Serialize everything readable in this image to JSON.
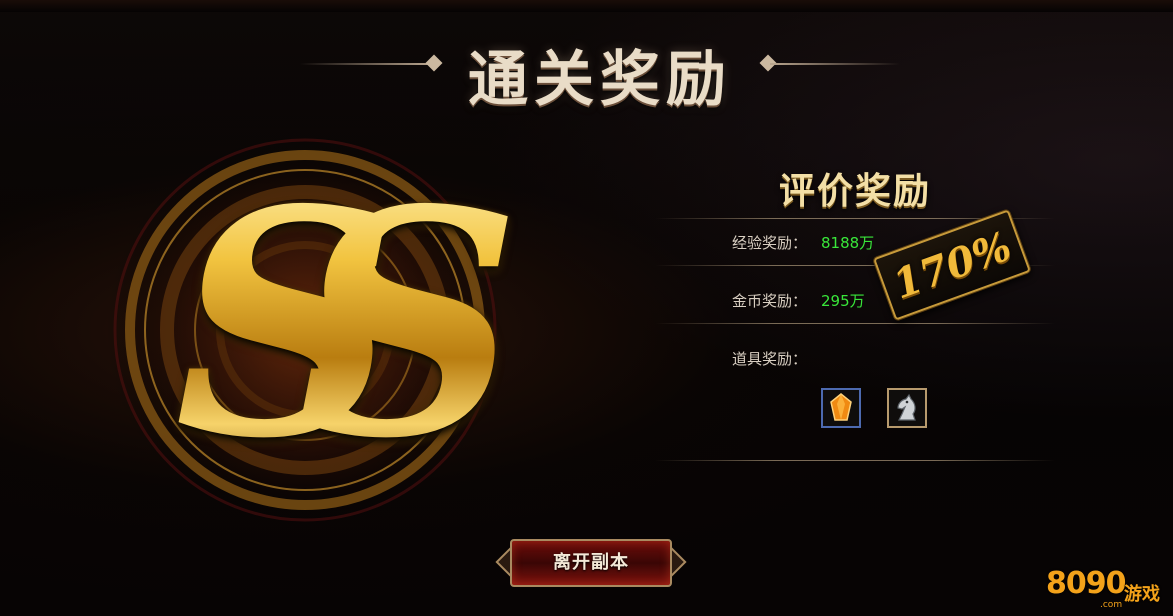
{
  "screen": {
    "title": "通关奖励",
    "leave_button": "离开副本"
  },
  "emblem": {
    "grade": "SS",
    "icon": "ss-grade-emblem"
  },
  "rewards": {
    "heading": "评价奖励",
    "exp_label": "经验奖励：",
    "exp_value": "8188万",
    "gold_label": "金币奖励：",
    "gold_value": "295万",
    "items_label": "道具奖励：",
    "items": [
      {
        "icon": "orange-gem-icon",
        "border": "#4d6ab0"
      },
      {
        "icon": "chess-knight-icon",
        "border": "#b79a6d"
      }
    ],
    "bonus_badge": "170%"
  },
  "watermark": {
    "number": "8090",
    "text": "游戏",
    "domain": ".com"
  },
  "colors": {
    "reward_value": "#39e63a",
    "gold_accent": "#e7b42c",
    "button_red": "#6e0d0a"
  }
}
